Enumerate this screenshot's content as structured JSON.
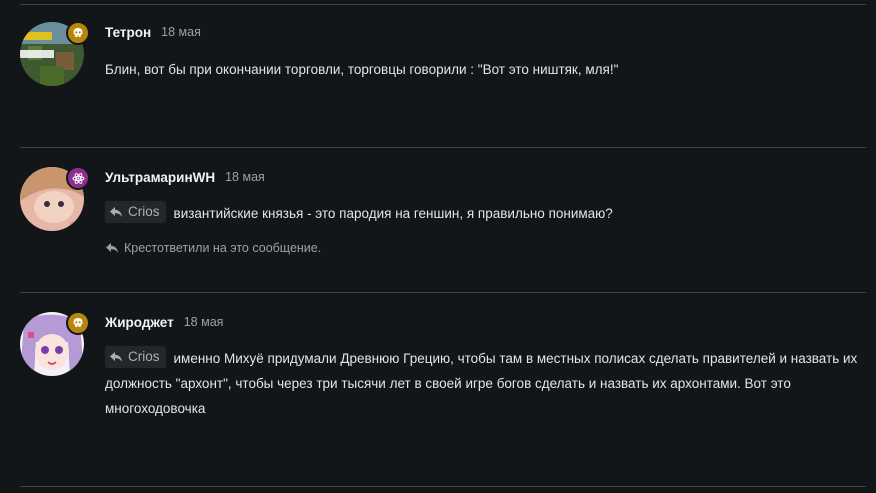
{
  "colors": {
    "background": "#131619",
    "badge_gold": "#b8860b",
    "badge_purple": "#8e2f8f",
    "quote_bg": "#23272b"
  },
  "messages": [
    {
      "author": "Тетрон",
      "date": "18 мая",
      "badge_icon": "skull-icon",
      "text": "Блин, вот бы при окончании торговли, торговцы говорили : \"Вот это ништяк, мля!\""
    },
    {
      "author": "УльтрамаринWH",
      "date": "18 мая",
      "badge_icon": "atom-icon",
      "quote_label": "Crios",
      "text": "византийские князья - это пародия на геншин, я правильно понимаю?",
      "reply_hint": "Крестответили на это сообщение."
    },
    {
      "author": "Жироджет",
      "date": "18 мая",
      "badge_icon": "skull-icon",
      "quote_label": "Crios",
      "text": "именно Михуё придумали Древнюю Грецию, чтобы там в местных полисах сделать правителей и назвать их должность \"архонт\", чтобы через три тысячи лет в своей игре богов сделать и назвать их архонтами. Вот это многоходовочка"
    }
  ]
}
